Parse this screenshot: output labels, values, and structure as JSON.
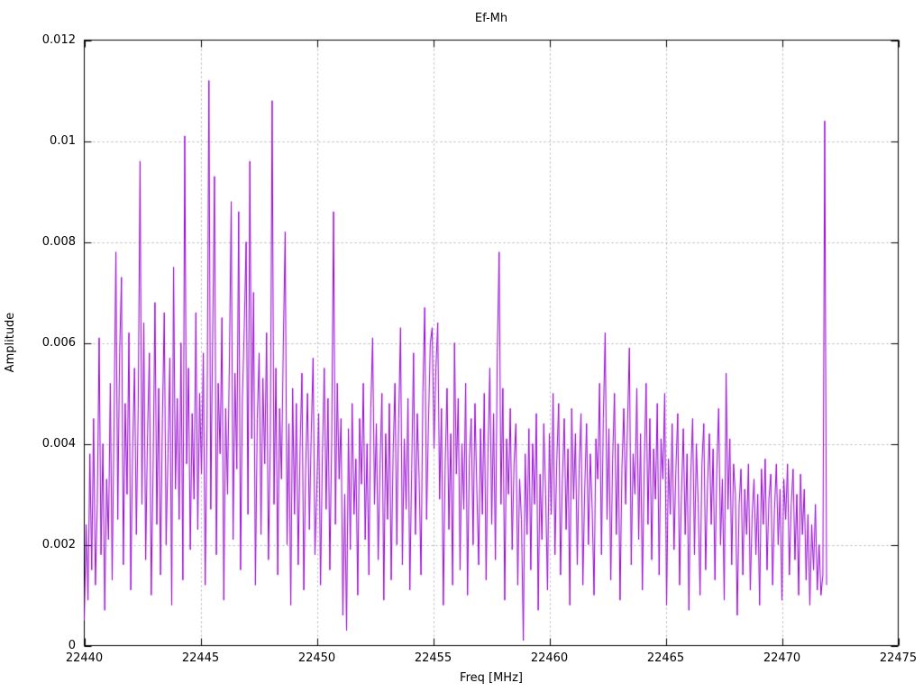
{
  "window": {
    "background": "#ffffff"
  },
  "chart_data": {
    "type": "line",
    "title": "Ef-Mh",
    "xlabel": "Freq [MHz]",
    "ylabel": "Amplitude",
    "xlim": [
      22440,
      22475
    ],
    "ylim": [
      0,
      0.012
    ],
    "x_ticks": [
      "22440",
      "22445",
      "22450",
      "22455",
      "22460",
      "22465",
      "22470",
      "22475"
    ],
    "y_ticks": [
      "0",
      "0.002",
      "0.004",
      "0.006",
      "0.008",
      "0.01",
      "0.012"
    ],
    "grid": "dotted-major-both-axes",
    "legend_position": "none",
    "style": {
      "line_color": "#9400d3",
      "grid_color": "#b3b3b3",
      "axis_color": "#000000",
      "text_color": "#000000",
      "background": "#ffffff"
    },
    "series": [
      {
        "name": "Ef-Mh",
        "x_start": 22440.0,
        "x_step": 0.08,
        "value_unit": 0.0001,
        "values": [
          5,
          24,
          9,
          38,
          15,
          45,
          12,
          28,
          61,
          18,
          40,
          7,
          33,
          21,
          52,
          13,
          44,
          78,
          25,
          58,
          73,
          16,
          48,
          30,
          62,
          11,
          39,
          55,
          22,
          47,
          96,
          28,
          64,
          17,
          42,
          58,
          10,
          35,
          68,
          24,
          51,
          14,
          45,
          66,
          20,
          38,
          57,
          8,
          75,
          31,
          49,
          25,
          60,
          13,
          101,
          36,
          55,
          19,
          46,
          29,
          66,
          23,
          50,
          34,
          58,
          12,
          44,
          112,
          27,
          61,
          93,
          18,
          52,
          38,
          65,
          9,
          47,
          30,
          56,
          88,
          21,
          54,
          35,
          86,
          15,
          49,
          63,
          80,
          26,
          96,
          41,
          70,
          12,
          45,
          58,
          22,
          53,
          36,
          62,
          17,
          40,
          108,
          28,
          55,
          14,
          47,
          33,
          60,
          82,
          20,
          44,
          8,
          51,
          26,
          48,
          16,
          39,
          54,
          11,
          35,
          50,
          23,
          42,
          57,
          18,
          31,
          46,
          12,
          38,
          55,
          27,
          49,
          15,
          41,
          86,
          24,
          52,
          33,
          45,
          6,
          30,
          3,
          43,
          19,
          48,
          26,
          37,
          10,
          45,
          32,
          52,
          21,
          40,
          14,
          47,
          61,
          28,
          44,
          17,
          36,
          50,
          9,
          42,
          25,
          48,
          13,
          38,
          52,
          20,
          45,
          63,
          16,
          41,
          27,
          49,
          11,
          35,
          58,
          22,
          46,
          33,
          14,
          50,
          67,
          25,
          44,
          60,
          63,
          39,
          55,
          64,
          29,
          47,
          8,
          36,
          51,
          23,
          42,
          12,
          60,
          34,
          49,
          15,
          40,
          27,
          52,
          10,
          37,
          45,
          20,
          48,
          31,
          16,
          43,
          26,
          50,
          13,
          38,
          55,
          24,
          46,
          17,
          58,
          78,
          28,
          51,
          9,
          41,
          30,
          47,
          19,
          36,
          44,
          12,
          33,
          25,
          1,
          38,
          22,
          43,
          15,
          40,
          28,
          46,
          7,
          34,
          21,
          44,
          30,
          11,
          42,
          26,
          50,
          18,
          37,
          48,
          14,
          33,
          45,
          23,
          39,
          8,
          47,
          29,
          42,
          16,
          35,
          46,
          12,
          31,
          44,
          20,
          38,
          27,
          10,
          41,
          33,
          52,
          18,
          45,
          62,
          25,
          43,
          13,
          37,
          50,
          22,
          40,
          9,
          35,
          47,
          28,
          44,
          59,
          16,
          38,
          30,
          51,
          21,
          42,
          11,
          36,
          52,
          24,
          45,
          17,
          39,
          29,
          48,
          14,
          41,
          33,
          50,
          8,
          37,
          26,
          44,
          19,
          35,
          46,
          12,
          30,
          43,
          22,
          38,
          7,
          34,
          45,
          18,
          40,
          28,
          10,
          36,
          44,
          15,
          32,
          42,
          24,
          39,
          13,
          35,
          47,
          20,
          33,
          9,
          54,
          27,
          41,
          16,
          36,
          30,
          6,
          28,
          35,
          14,
          31,
          22,
          36,
          11,
          26,
          33,
          18,
          30,
          8,
          35,
          24,
          37,
          15,
          29,
          34,
          12,
          27,
          36,
          20,
          31,
          9,
          33,
          25,
          36,
          14,
          28,
          35,
          17,
          30,
          10,
          34,
          22,
          31,
          13,
          26,
          8,
          24,
          15,
          28,
          11,
          20,
          10,
          14,
          104,
          12
        ]
      }
    ]
  }
}
